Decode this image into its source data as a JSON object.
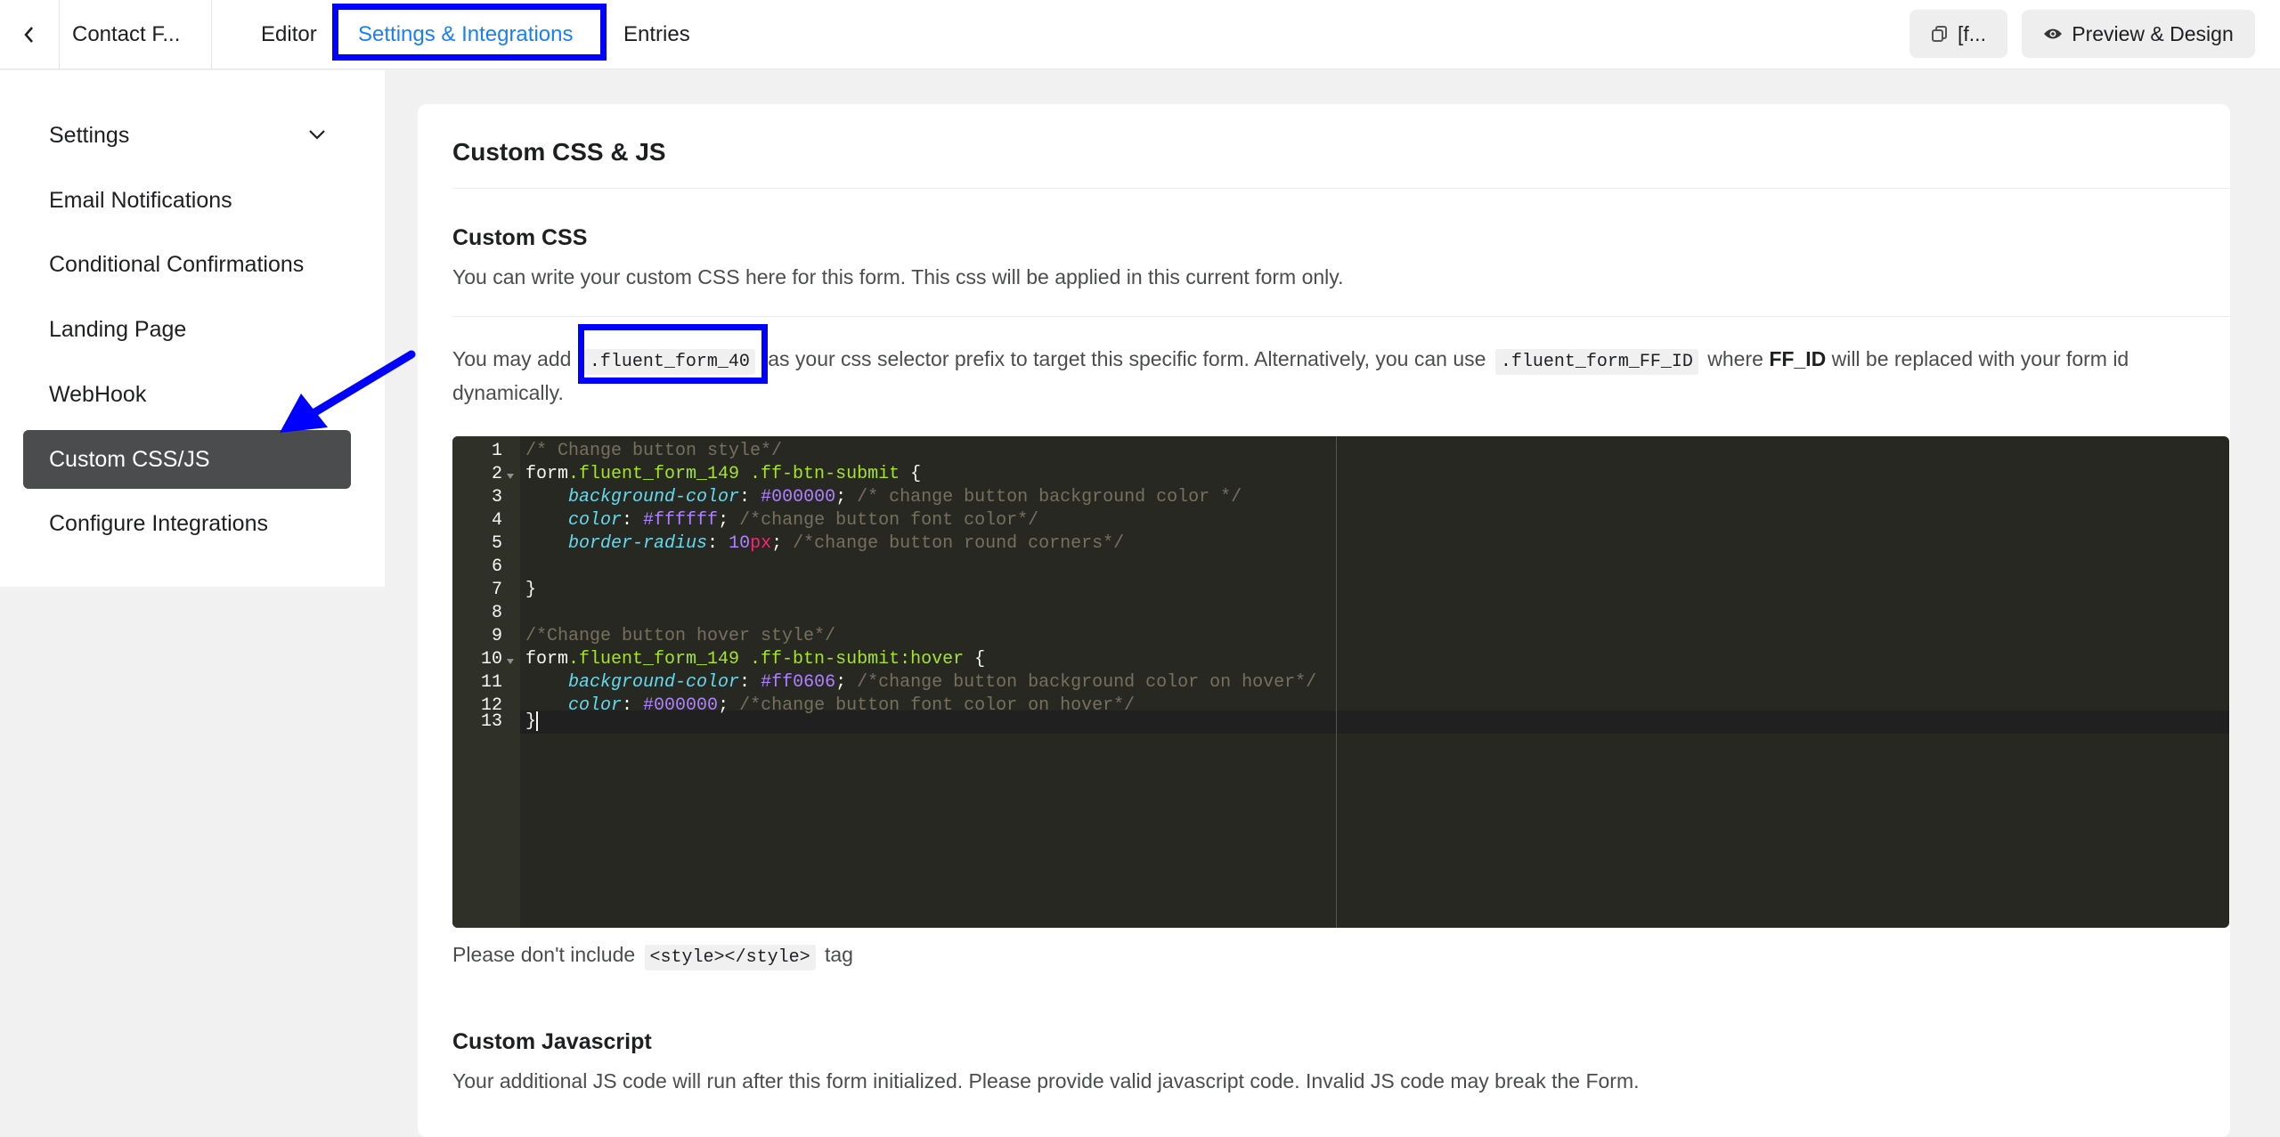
{
  "header": {
    "form_name": "Contact F...",
    "tabs": [
      {
        "label": "Editor"
      },
      {
        "label": "Settings & Integrations"
      },
      {
        "label": "Entries"
      }
    ],
    "shortcode_label": "[f...",
    "preview_label": "Preview & Design"
  },
  "sidebar": {
    "items": [
      {
        "label": "Settings"
      },
      {
        "label": "Email Notifications"
      },
      {
        "label": "Conditional Confirmations"
      },
      {
        "label": "Landing Page"
      },
      {
        "label": "WebHook"
      },
      {
        "label": "Custom CSS/JS"
      },
      {
        "label": "Configure Integrations"
      }
    ]
  },
  "main": {
    "title": "Custom CSS & JS",
    "css_section": {
      "heading": "Custom CSS",
      "description": "You can write your custom CSS here for this form. This css will be applied in this current form only.",
      "hint_1": "You may add",
      "selector": ".fluent_form_40",
      "hint_2": "as your css selector prefix to target this specific form. Alternatively, you can use",
      "generic_selector": ".fluent_form_FF_ID",
      "hint_3": "where",
      "ff_id": "FF_ID",
      "hint_4": "will be replaced with your form id",
      "hint_5": "dynamically.",
      "note_1": "Please don't include",
      "style_tag": "<style></style>",
      "note_2": "tag"
    },
    "js_section": {
      "heading": "Custom Javascript",
      "description": "Your additional JS code will run after this form initialized. Please provide valid javascript code. Invalid JS code may break the Form."
    }
  },
  "code": {
    "line_numbers": [
      "1",
      "2",
      "3",
      "4",
      "5",
      "6",
      "7",
      "8",
      "9",
      "10",
      "11",
      "12",
      "13"
    ],
    "l1": "/* Change button style*/",
    "l2_a": "form",
    "l2_b": ".fluent_form_149",
    "l2_c": " .ff-btn-submit",
    "l2_d": " {",
    "l3_a": "background-color",
    "l3_b": ": ",
    "l3_c": "#000000",
    "l3_d": "; ",
    "l3_e": "/* change button background color */",
    "l4_a": "color",
    "l4_b": ": ",
    "l4_c": "#ffffff",
    "l4_d": "; ",
    "l4_e": "/*change button font color*/",
    "l5_a": "border-radius",
    "l5_b": ": ",
    "l5_c": "10",
    "l5_d": "px",
    "l5_e": "; ",
    "l5_f": "/*change button round corners*/",
    "l7": "}",
    "l9": "/*Change button hover style*/",
    "l10_a": "form",
    "l10_b": ".fluent_form_149",
    "l10_c": " .ff-btn-submit:hover",
    "l10_d": " {",
    "l11_a": "background-color",
    "l11_b": ": ",
    "l11_c": "#ff0606",
    "l11_d": "; ",
    "l11_e": "/*change button background color on hover*/",
    "l12_a": "color",
    "l12_b": ": ",
    "l12_c": "#000000",
    "l12_d": "; ",
    "l12_e": "/*change button font color on hover*/",
    "l13": "}"
  },
  "colors": {
    "accent": "#1a7efb",
    "highlight_annotation": "#0000ff",
    "active_sidebar": "#4b4c4d",
    "editor_bg": "#272822"
  },
  "icons": [
    "chevron-left-icon",
    "chevron-down-icon",
    "copy-icon",
    "eye-icon",
    "arrow-annotation"
  ]
}
